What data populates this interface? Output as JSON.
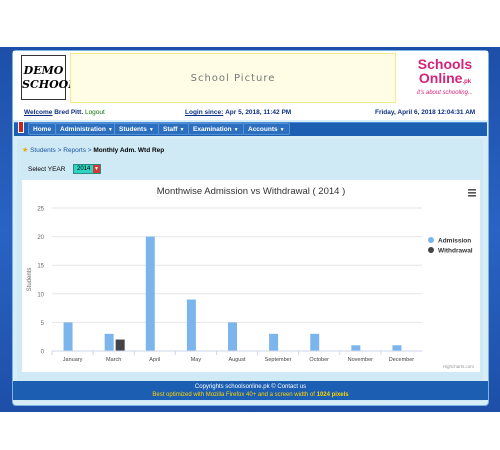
{
  "header": {
    "logo_line1": "DEMO",
    "logo_line2": "SCHOOL",
    "picture_text": "School Picture",
    "brand_line1": "Schools",
    "brand_line2": "Online",
    "brand_suffix": ".pk",
    "brand_tagline": "it's about schooling..."
  },
  "infobar": {
    "welcome_label": "Welcome",
    "user": "Bred Pitt.",
    "logout": "Logout",
    "login_label": "Login since:",
    "login_value": "Apr 5, 2018, 11:42 PM",
    "date": "Friday, April 6, 2018 12:04:31 AM"
  },
  "nav": {
    "items": [
      "Home",
      "Administration",
      "Students",
      "Staff",
      "Examination",
      "Accounts"
    ]
  },
  "breadcrumb": {
    "part1": "Students",
    "sep": ">",
    "part2": "Reports",
    "current": "Monthly Adm. Wtd Rep"
  },
  "filter": {
    "year_label": "Select YEAR",
    "year_value": "2014"
  },
  "chart_data": {
    "type": "bar",
    "title": "Monthwise Admission vs Withdrawal ( 2014 )",
    "ylabel": "Students",
    "xlabel": "",
    "ylim": [
      0,
      25
    ],
    "yticks": [
      0,
      5,
      10,
      15,
      20,
      25
    ],
    "categories": [
      "January",
      "March",
      "April",
      "May",
      "August",
      "September",
      "October",
      "November",
      "December"
    ],
    "series": [
      {
        "name": "Admission",
        "color": "#7cb5ec",
        "values": [
          5,
          3,
          20,
          9,
          5,
          3,
          3,
          1,
          1
        ]
      },
      {
        "name": "Withdrawal",
        "color": "#434348",
        "values": [
          0,
          2,
          0,
          0,
          0,
          0,
          0,
          0,
          0
        ]
      }
    ],
    "legend": "right",
    "credit": "Highcharts.com",
    "menu_icon": "hamburger-icon"
  },
  "footer": {
    "line1": "Copyrights schoolsonline.pk © Contact us",
    "line2_pre": "Best optimized with Mozilla Firefox 40+ and a screen width of ",
    "line2_bold": "1024 pixels"
  }
}
